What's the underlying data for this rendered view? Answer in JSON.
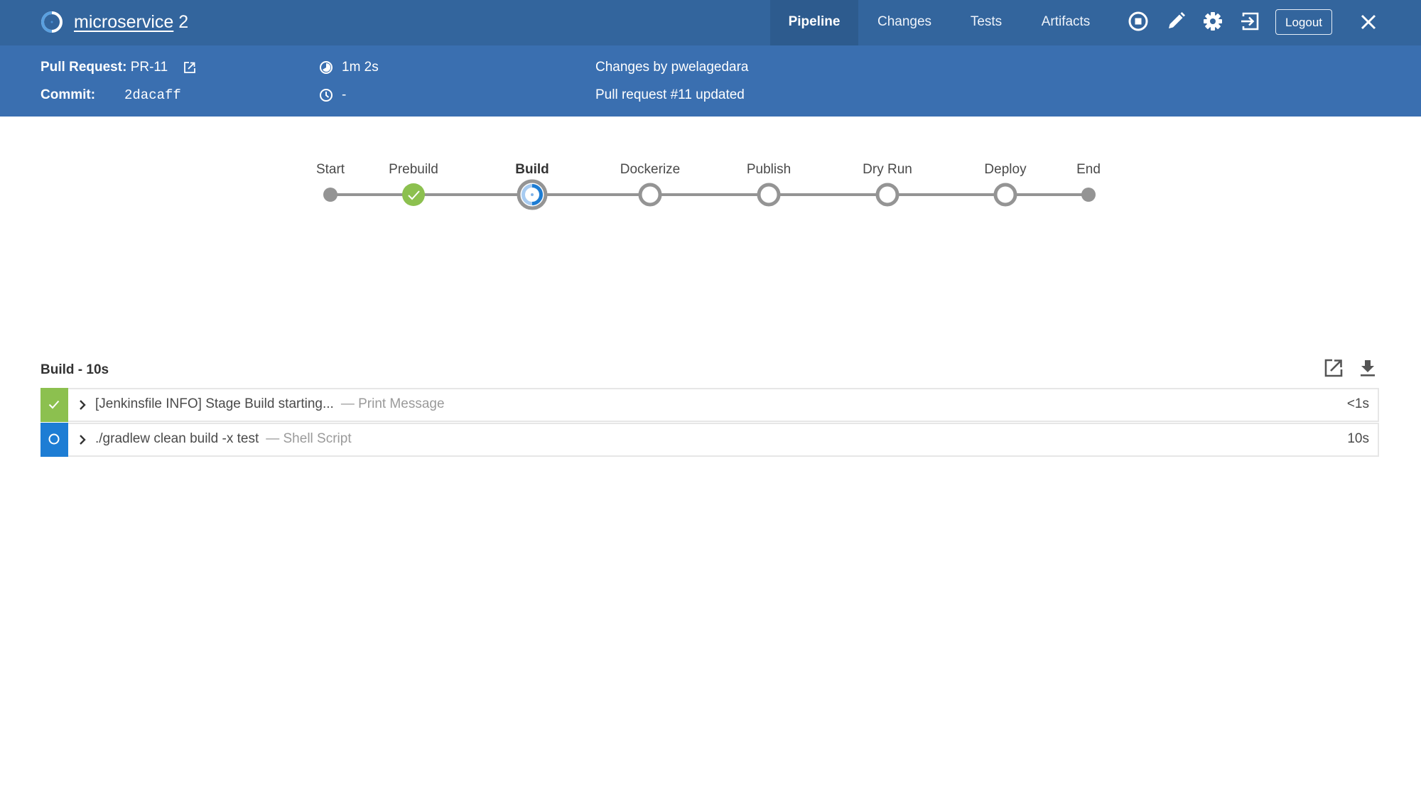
{
  "header": {
    "title_name": "microservice",
    "title_run": "2",
    "tabs": [
      {
        "label": "Pipeline",
        "active": true
      },
      {
        "label": "Changes",
        "active": false
      },
      {
        "label": "Tests",
        "active": false
      },
      {
        "label": "Artifacts",
        "active": false
      }
    ],
    "icons": [
      "stop-icon",
      "edit-icon",
      "settings-icon",
      "exit-icon"
    ],
    "logout_label": "Logout",
    "close_icon": "close-icon"
  },
  "run_info": {
    "pull_request_label": "Pull Request:",
    "pull_request_value": "PR-11",
    "commit_label": "Commit:",
    "commit_value": "2dacaff",
    "duration": "1m 2s",
    "started": "-",
    "changes_by": "Changes by pwelagedara",
    "cause": "Pull request #11 updated"
  },
  "pipeline": {
    "stages": [
      {
        "label": "Start",
        "status": "terminal"
      },
      {
        "label": "Prebuild",
        "status": "success"
      },
      {
        "label": "Build",
        "status": "running",
        "current": true
      },
      {
        "label": "Dockerize",
        "status": "not_built"
      },
      {
        "label": "Publish",
        "status": "not_built"
      },
      {
        "label": "Dry Run",
        "status": "not_built"
      },
      {
        "label": "Deploy",
        "status": "not_built"
      },
      {
        "label": "End",
        "status": "terminal"
      }
    ],
    "colors": {
      "success": "#8cc04f",
      "running": "#1d7dd4",
      "running_light": "#a7cbf1",
      "line": "#949494"
    }
  },
  "steps_panel": {
    "title": "Build - 10s",
    "actions": [
      "open-in-new-icon",
      "download-icon"
    ],
    "steps": [
      {
        "status": "success",
        "text": "[Jenkinsfile INFO] Stage Build starting...",
        "type": "— Print Message",
        "duration": "<1s"
      },
      {
        "status": "running",
        "text": "./gradlew clean build -x test",
        "type": "— Shell Script",
        "duration": "10s"
      }
    ]
  }
}
